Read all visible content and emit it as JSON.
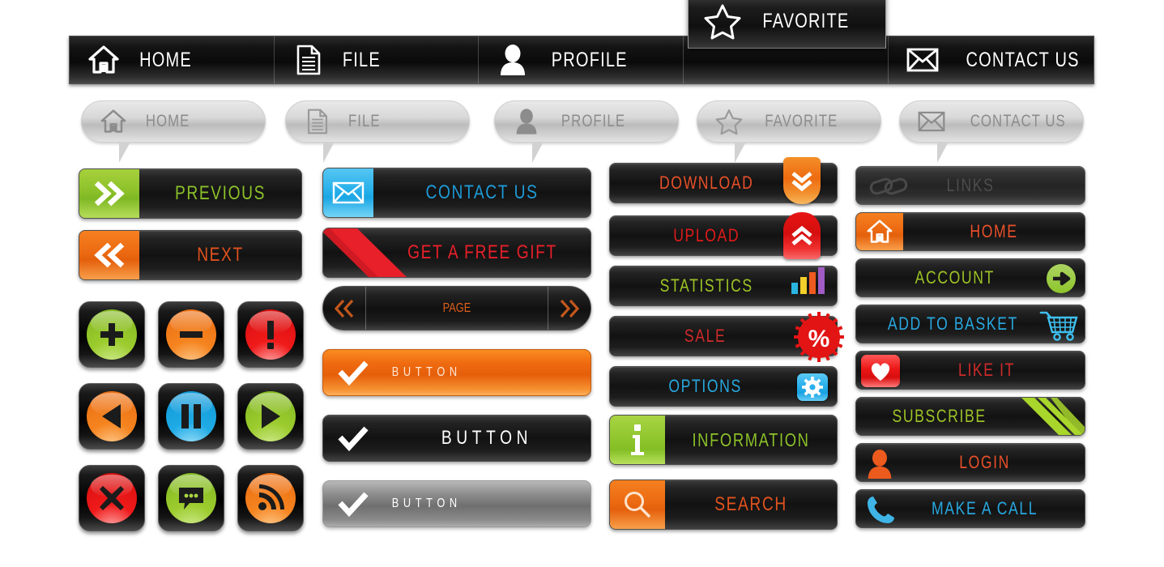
{
  "nav": {
    "items": [
      {
        "label": "HOME",
        "icon": "home-icon",
        "active": false
      },
      {
        "label": "FILE",
        "icon": "file-icon",
        "active": false
      },
      {
        "label": "PROFILE",
        "icon": "person-icon",
        "active": false
      },
      {
        "label": "FAVORITE",
        "icon": "star-icon",
        "active": true
      },
      {
        "label": "CONTACT US",
        "icon": "envelope-icon",
        "active": false
      }
    ]
  },
  "pills": {
    "items": [
      {
        "label": "HOME",
        "icon": "home-icon"
      },
      {
        "label": "FILE",
        "icon": "file-icon"
      },
      {
        "label": "PROFILE",
        "icon": "person-icon"
      },
      {
        "label": "FAVORITE",
        "icon": "star-icon"
      },
      {
        "label": "CONTACT US",
        "icon": "envelope-icon"
      }
    ]
  },
  "column1": {
    "previous": {
      "label": "PREVIOUS",
      "icon": "double-chevron-right-icon",
      "cap_color": "#8cc12a",
      "text_color": "#8cc12a"
    },
    "next": {
      "label": "NEXT",
      "icon": "double-chevron-left-icon",
      "cap_color": "#ec6a12",
      "text_color": "#e0521e"
    },
    "tiles": [
      {
        "name": "add-button",
        "icon": "plus-icon",
        "color": "#9ccc2e"
      },
      {
        "name": "remove-button",
        "icon": "minus-icon",
        "color": "#f5841f"
      },
      {
        "name": "alert-button",
        "icon": "exclamation-icon",
        "color": "#f01a1a"
      },
      {
        "name": "previous-button",
        "icon": "play-left-icon",
        "color": "#f5841f"
      },
      {
        "name": "pause-button",
        "icon": "pause-icon",
        "color": "#1fabe6"
      },
      {
        "name": "play-button",
        "icon": "play-right-icon",
        "color": "#9ccc2e"
      },
      {
        "name": "close-button",
        "icon": "cross-icon",
        "color": "#f01a1a"
      },
      {
        "name": "chat-button",
        "icon": "chat-bubble-icon",
        "color": "#9ccc2e"
      },
      {
        "name": "rss-button",
        "icon": "rss-icon",
        "color": "#f5841f"
      }
    ]
  },
  "column2": {
    "contact_us": {
      "label": "CONTACT US",
      "icon": "envelope-icon",
      "cap_color": "#27b0ea",
      "text_color": "#1e9ad6"
    },
    "free_gift": {
      "label": "GET A FREE GIFT",
      "icon": "gift-icon",
      "ribbon_color": "#e8202a",
      "text_color": "#e8202a"
    },
    "page": {
      "label": "PAGE",
      "prev_icon": "double-chevron-left-icon",
      "next_icon": "double-chevron-right-icon",
      "text_color": "#e0601c"
    },
    "buttons": [
      {
        "label": "BUTTON",
        "variant": "orange",
        "icon": "check-icon",
        "text_color": "#ffe9d6"
      },
      {
        "label": "BUTTON",
        "variant": "black",
        "icon": "check-icon",
        "text_color": "#ffffff"
      },
      {
        "label": "BUTTON",
        "variant": "gray",
        "icon": "check-icon",
        "text_color": "#ffffff"
      }
    ]
  },
  "column3": {
    "items": [
      {
        "label": "DOWNLOAD",
        "icon": "download-chevron-icon",
        "text_color": "#e8502a",
        "badge_color": "#f07a18"
      },
      {
        "label": "UPLOAD",
        "icon": "upload-chevron-icon",
        "text_color": "#e01b1b",
        "badge_color": "#e81414"
      },
      {
        "label": "STATISTICS",
        "icon": "bar-chart-icon",
        "text_color": "#9dc327",
        "badge_color": ""
      },
      {
        "label": "SALE",
        "icon": "percent-starburst-icon",
        "text_color": "#cf2b2b",
        "badge_color": "#e21414"
      },
      {
        "label": "OPTIONS",
        "icon": "gear-icon",
        "text_color": "#28a8e0",
        "badge_color": "#29b0ec"
      },
      {
        "label": "INFORMATION",
        "icon": "info-icon",
        "text_color": "#8cc12a",
        "badge_color": "#8ec52c"
      },
      {
        "label": "SEARCH",
        "icon": "magnifier-icon",
        "text_color": "#e0521e",
        "badge_color": "#ec6a12"
      }
    ]
  },
  "column4": {
    "items": [
      {
        "label": "LINKS",
        "icon": "chain-link-icon",
        "text_color": "#3e3e3e",
        "disabled": true
      },
      {
        "label": "HOME",
        "icon": "home-icon",
        "text_color": "#e8502a",
        "disabled": false
      },
      {
        "label": "ACCOUNT",
        "icon": "arrow-right-icon",
        "text_color": "#9dc327",
        "disabled": false
      },
      {
        "label": "ADD TO BASKET",
        "icon": "shopping-cart-icon",
        "text_color": "#28a8e0",
        "disabled": false
      },
      {
        "label": "LIKE IT",
        "icon": "heart-icon",
        "text_color": "#cf2b2b",
        "disabled": false
      },
      {
        "label": "SUBSCRIBE",
        "icon": "stripes-icon",
        "text_color": "#9dc327",
        "disabled": false
      },
      {
        "label": "LOGIN",
        "icon": "person-icon",
        "text_color": "#e8502a",
        "disabled": false
      },
      {
        "label": "MAKE A CALL",
        "icon": "phone-icon",
        "text_color": "#28a8e0",
        "disabled": false
      }
    ]
  }
}
